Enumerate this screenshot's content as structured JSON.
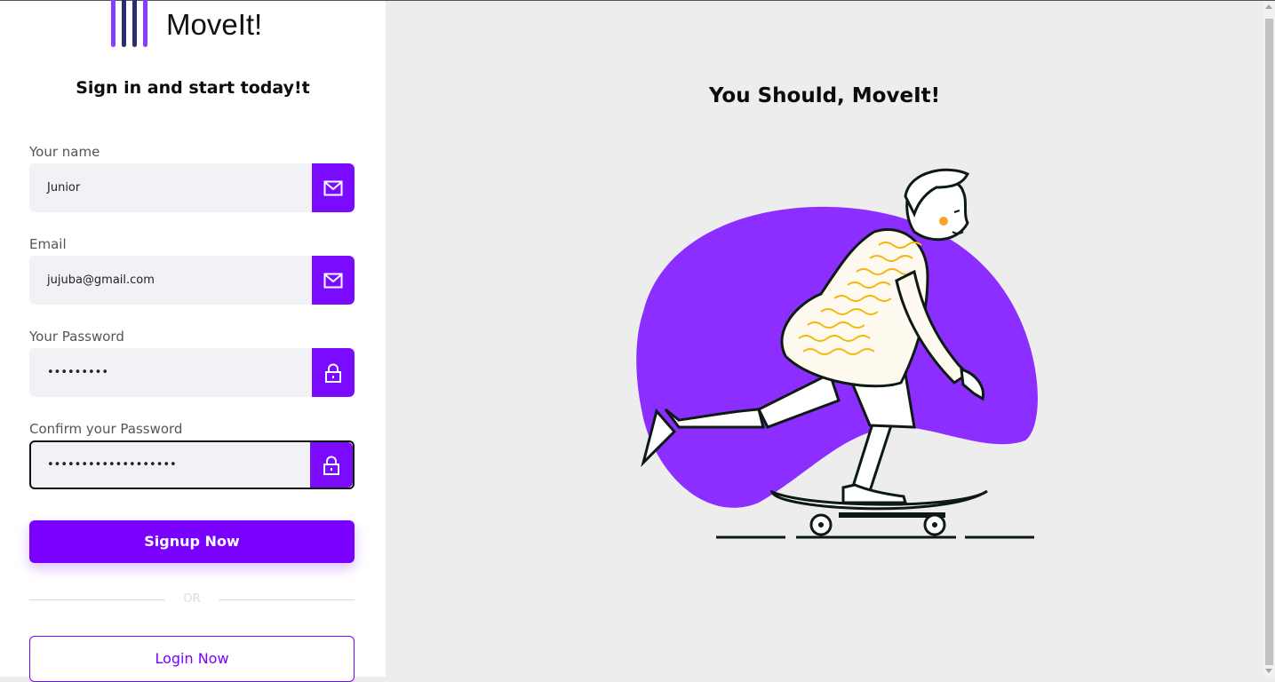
{
  "brand": {
    "name": "MoveIt!",
    "accent_color": "#7a00ff",
    "bar_colors": [
      "#8b3dff",
      "#2b2d6e",
      "#2b2d6e",
      "#8b3dff"
    ]
  },
  "form": {
    "heading": "Sign in and start today!t",
    "fields": [
      {
        "label": "Your name",
        "value": "Junior",
        "icon": "mail-icon"
      },
      {
        "label": "Email",
        "value": "jujuba@gmail.com",
        "icon": "mail-icon"
      },
      {
        "label": "Your Password",
        "value": "•••••••••",
        "icon": "lock-icon"
      },
      {
        "label": "Confirm your Password",
        "value": "•••••••••••••••••••",
        "icon": "lock-icon"
      }
    ],
    "signup_label": "Signup Now",
    "or_label": "OR",
    "login_label": "Login Now"
  },
  "hero": {
    "title": "You Should, MoveIt!",
    "blob_color": "#8c2eff"
  }
}
